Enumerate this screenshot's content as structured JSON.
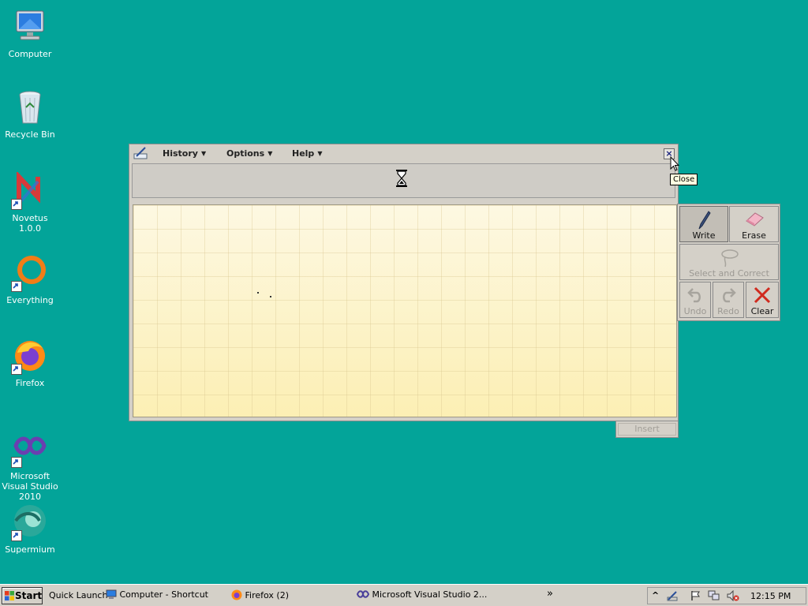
{
  "desktop": {
    "icons": [
      {
        "label": "Computer",
        "icon": "computer-icon"
      },
      {
        "label": "Recycle Bin",
        "icon": "recycle-bin-icon"
      },
      {
        "label": "Novetus 1.0.0",
        "icon": "novetus-icon"
      },
      {
        "label": "Everything",
        "icon": "everything-icon"
      },
      {
        "label": "Firefox",
        "icon": "firefox-icon"
      },
      {
        "label": "Microsoft Visual Studio 2010",
        "icon": "visual-studio-icon"
      },
      {
        "label": "Supermium",
        "icon": "supermium-icon"
      }
    ]
  },
  "tip": {
    "menu": {
      "history": "History",
      "options": "Options",
      "help": "Help",
      "arrow": "▼"
    },
    "close_glyph": "×",
    "tooltip": "Close",
    "status_icon": "hourglass-icon",
    "tools": {
      "write": "Write",
      "erase": "Erase",
      "select_correct": "Select and Correct",
      "undo": "Undo",
      "redo": "Redo",
      "clear": "Clear"
    },
    "insert": "Insert"
  },
  "taskbar": {
    "start": "Start",
    "quick_launch": "Quick Launch",
    "items": [
      {
        "label": "Computer - Shortcut",
        "icon": "computer-icon"
      },
      {
        "label": "Firefox (2)",
        "icon": "firefox-icon"
      },
      {
        "label": "Microsoft Visual Studio 2...",
        "icon": "visual-studio-icon"
      }
    ],
    "overflow": "»",
    "tray_chevron": "^",
    "clock": "12:15 PM"
  },
  "colors": {
    "desktop": "#03a499",
    "window": "#d4d0c8",
    "canvas": "#fdf6cf",
    "tooltip_bg": "#ffffe1",
    "clear_x": "#d02a1e"
  }
}
